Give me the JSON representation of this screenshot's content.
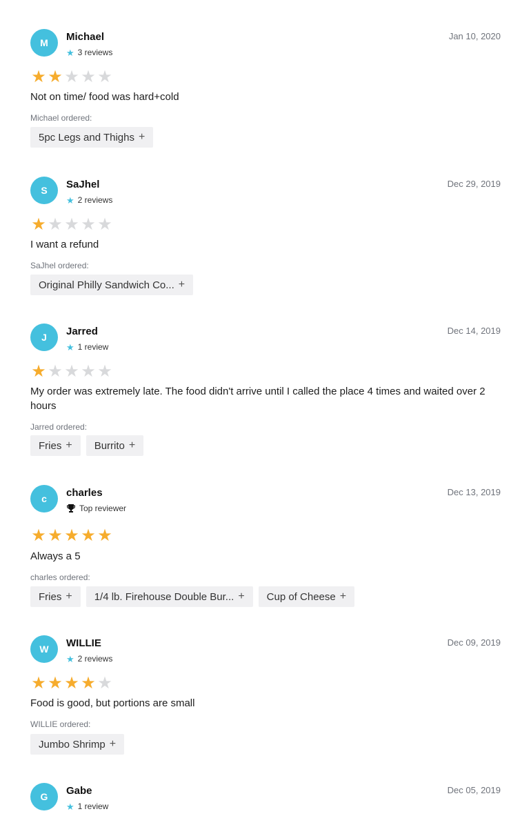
{
  "reviews": [
    {
      "initial": "M",
      "name": "Michael",
      "meta": "3 reviews",
      "meta_icon": "star-icon",
      "date": "Jan 10, 2020",
      "rating": 2,
      "text": "Not on time/ food was hard+cold",
      "ordered_label": "Michael ordered:",
      "items": [
        "5pc Legs and Thighs"
      ]
    },
    {
      "initial": "S",
      "name": "SaJhel",
      "meta": "2 reviews",
      "meta_icon": "star-icon",
      "date": "Dec 29, 2019",
      "rating": 1,
      "text": "I want a refund",
      "ordered_label": "SaJhel ordered:",
      "items": [
        "Original Philly Sandwich Co..."
      ]
    },
    {
      "initial": "J",
      "name": "Jarred",
      "meta": "1 review",
      "meta_icon": "star-icon",
      "date": "Dec 14, 2019",
      "rating": 1,
      "text": "My order was extremely late. The food didn't arrive until I called the place 4 times and waited over 2 hours",
      "ordered_label": "Jarred ordered:",
      "items": [
        "Fries",
        "Burrito"
      ]
    },
    {
      "initial": "c",
      "name": "charles",
      "meta": "Top reviewer",
      "meta_icon": "trophy-icon",
      "date": "Dec 13, 2019",
      "rating": 5,
      "text": "Always a 5",
      "ordered_label": "charles ordered:",
      "items": [
        "Fries",
        "1/4 lb. Firehouse Double Bur...",
        "Cup of Cheese"
      ]
    },
    {
      "initial": "W",
      "name": "WILLIE",
      "meta": "2 reviews",
      "meta_icon": "star-icon",
      "date": "Dec 09, 2019",
      "rating": 4,
      "text": "Food is good, but portions are small",
      "ordered_label": "WILLIE ordered:",
      "items": [
        "Jumbo Shrimp"
      ]
    },
    {
      "initial": "G",
      "name": "Gabe",
      "meta": "1 review",
      "meta_icon": "star-icon",
      "date": "Dec 05, 2019",
      "rating": null,
      "text": "",
      "ordered_label": "",
      "items": []
    }
  ],
  "plus_glyph": "+",
  "star_glyph": "★",
  "colors": {
    "avatar": "#44c0de",
    "star_on": "#f6ac2d",
    "star_off": "#d8d9db",
    "chip_bg": "#f0f0f2"
  }
}
